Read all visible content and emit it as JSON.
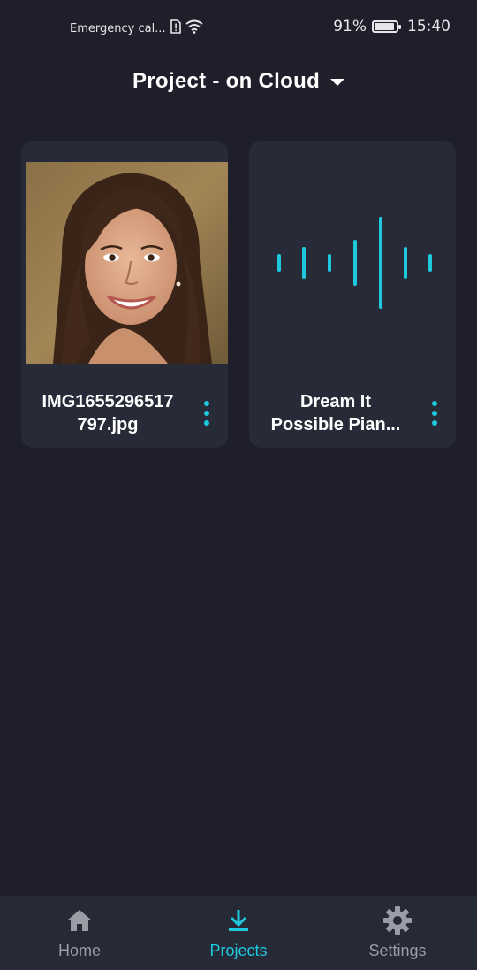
{
  "status_bar": {
    "carrier_text": "Emergency cal...",
    "battery_percent": "91%",
    "battery_level": 0.91,
    "time": "15:40",
    "icons": [
      "sim-alert-icon",
      "wifi-icon",
      "battery-icon"
    ]
  },
  "header": {
    "title": "Project - on Cloud",
    "dropdown_icon": "caret-down-icon"
  },
  "projects": [
    {
      "title_line1": "IMG1655296517",
      "title_line2": "797.jpg",
      "thumbnail": "photo-portrait",
      "menu_icon": "more-vertical-icon"
    },
    {
      "title_line1": "Dream It",
      "title_line2": "Possible Pian...",
      "thumbnail": "audio-waveform",
      "menu_icon": "more-vertical-icon"
    }
  ],
  "bottom_nav": {
    "items": [
      {
        "label": "Home",
        "icon": "home-icon",
        "active": false
      },
      {
        "label": "Projects",
        "icon": "download-icon",
        "active": true
      },
      {
        "label": "Settings",
        "icon": "gear-icon",
        "active": false
      }
    ]
  },
  "colors": {
    "background": "#1f1e2b",
    "card": "#272b38",
    "accent": "#1ec8dd",
    "nav_inactive": "#9a9ca6",
    "nav_background": "#262a37"
  }
}
